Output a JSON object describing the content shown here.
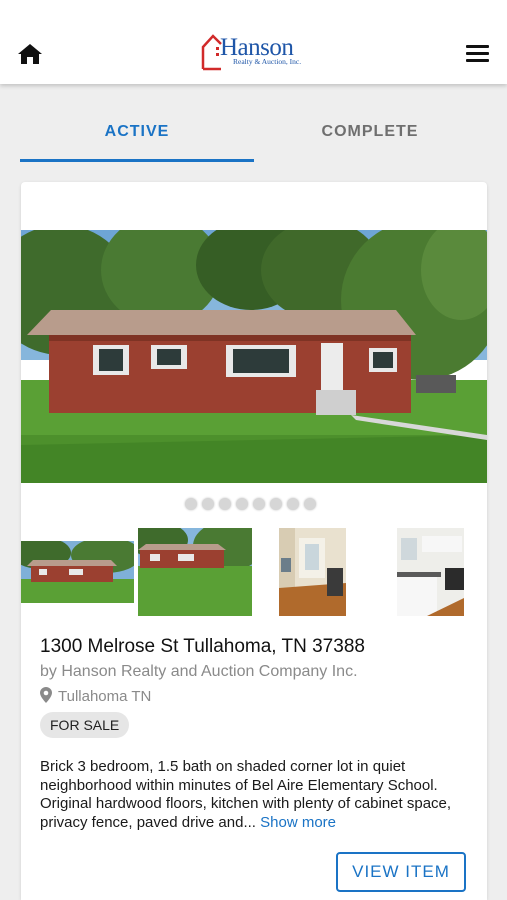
{
  "header": {
    "logo_text": "Hanson",
    "logo_subtext": "Realty & Auction, Inc.",
    "home_icon": "home-icon",
    "menu_icon": "hamburger-menu-icon"
  },
  "tabs": [
    {
      "label": "ACTIVE",
      "selected": true
    },
    {
      "label": "COMPLETE",
      "selected": false
    }
  ],
  "listing": {
    "address": "1300 Melrose St Tullahoma, TN 37388",
    "company": "by Hanson Realty and Auction Company Inc.",
    "location": "Tullahoma TN",
    "status": "FOR SALE",
    "description": "Brick 3 bedroom, 1.5 bath on shaded corner lot in quiet neighborhood within minutes of Bel Aire Elementary School. Original hardwood floors, kitchen with plenty of cabinet space, privacy fence, paved drive and...",
    "show_more": "Show more",
    "view_button": "VIEW ITEM",
    "photo_count": 8
  },
  "colors": {
    "accent": "#1a73c5",
    "logo_blue": "#1f56a8",
    "logo_red": "#d12a2a",
    "background": "#eeeeee"
  }
}
